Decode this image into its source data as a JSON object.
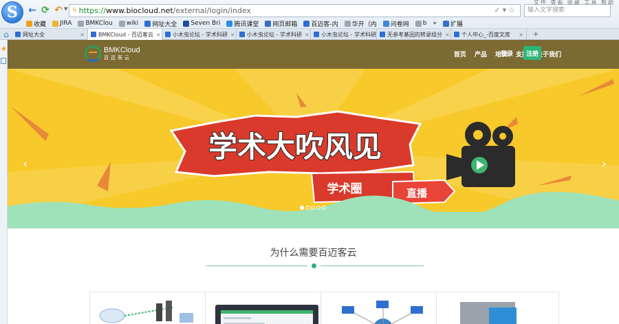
{
  "browser": {
    "logo_letter": "S",
    "url_https": "https://",
    "url_domain": "www.biocloud.net",
    "url_path": "/external/login/index",
    "search_placeholder": "输入文字搜索",
    "top_right_menu": "文件 查看 收藏 工具 帮助",
    "bookmarks": [
      {
        "label": "收藏",
        "icon": "star-icon",
        "color": "#f3a11c"
      },
      {
        "label": "JIRA",
        "icon": "jira-icon",
        "color": "#f2b233"
      },
      {
        "label": "BMKClou",
        "icon": "page-icon",
        "color": "#9aa7b4"
      },
      {
        "label": "wiki",
        "icon": "page-icon",
        "color": "#9aa7b4"
      },
      {
        "label": "网址大全",
        "icon": "globe-icon",
        "color": "#2f6fd1"
      },
      {
        "label": "Seven Bri",
        "icon": "seven-icon",
        "color": "#1e4e96"
      },
      {
        "label": "腾讯课堂",
        "icon": "tencent-icon",
        "color": "#2c8de8"
      },
      {
        "label": "网页邮箱",
        "icon": "mail-icon",
        "color": "#3a6fc4"
      },
      {
        "label": "百迈客-内",
        "icon": "globe-icon",
        "color": "#2f6fd1"
      },
      {
        "label": "华开（内",
        "icon": "page-icon",
        "color": "#9aa7b4"
      },
      {
        "label": "问卷网",
        "icon": "survey-icon",
        "color": "#3c8ad6"
      },
      {
        "label": "b",
        "icon": "page-icon",
        "color": "#9aa7b4"
      },
      {
        "label": "»",
        "icon": "",
        "color": ""
      },
      {
        "label": "扩展",
        "icon": "extension-icon",
        "color": "#3a6fc4"
      }
    ],
    "tabs": [
      {
        "label": "网址大全",
        "active": false
      },
      {
        "label": "BMKCloud - 百迈客云",
        "active": true
      },
      {
        "label": "小木虫论坛 - 学术科研",
        "active": false
      },
      {
        "label": "小木虫论坛 - 学术科研",
        "active": false
      },
      {
        "label": "小木虫论坛 - 学术科研",
        "active": false
      },
      {
        "label": "无参考基因的转录组分",
        "active": false
      },
      {
        "label": "个人中心_-百度文库",
        "active": false
      }
    ],
    "new_tab": "+"
  },
  "site": {
    "logo_name": "BMKCloud",
    "logo_sub": "百迈客云",
    "menu": [
      "首页",
      "产品",
      "培训",
      "支持",
      "关于我们"
    ],
    "login": "登录",
    "register": "注册",
    "banner": {
      "headline": "学术大吹风见",
      "tag": "学术圈",
      "live": "直播",
      "slide_count": 5,
      "active_slide": 1
    },
    "section_title": "为什么需要百迈客云"
  }
}
